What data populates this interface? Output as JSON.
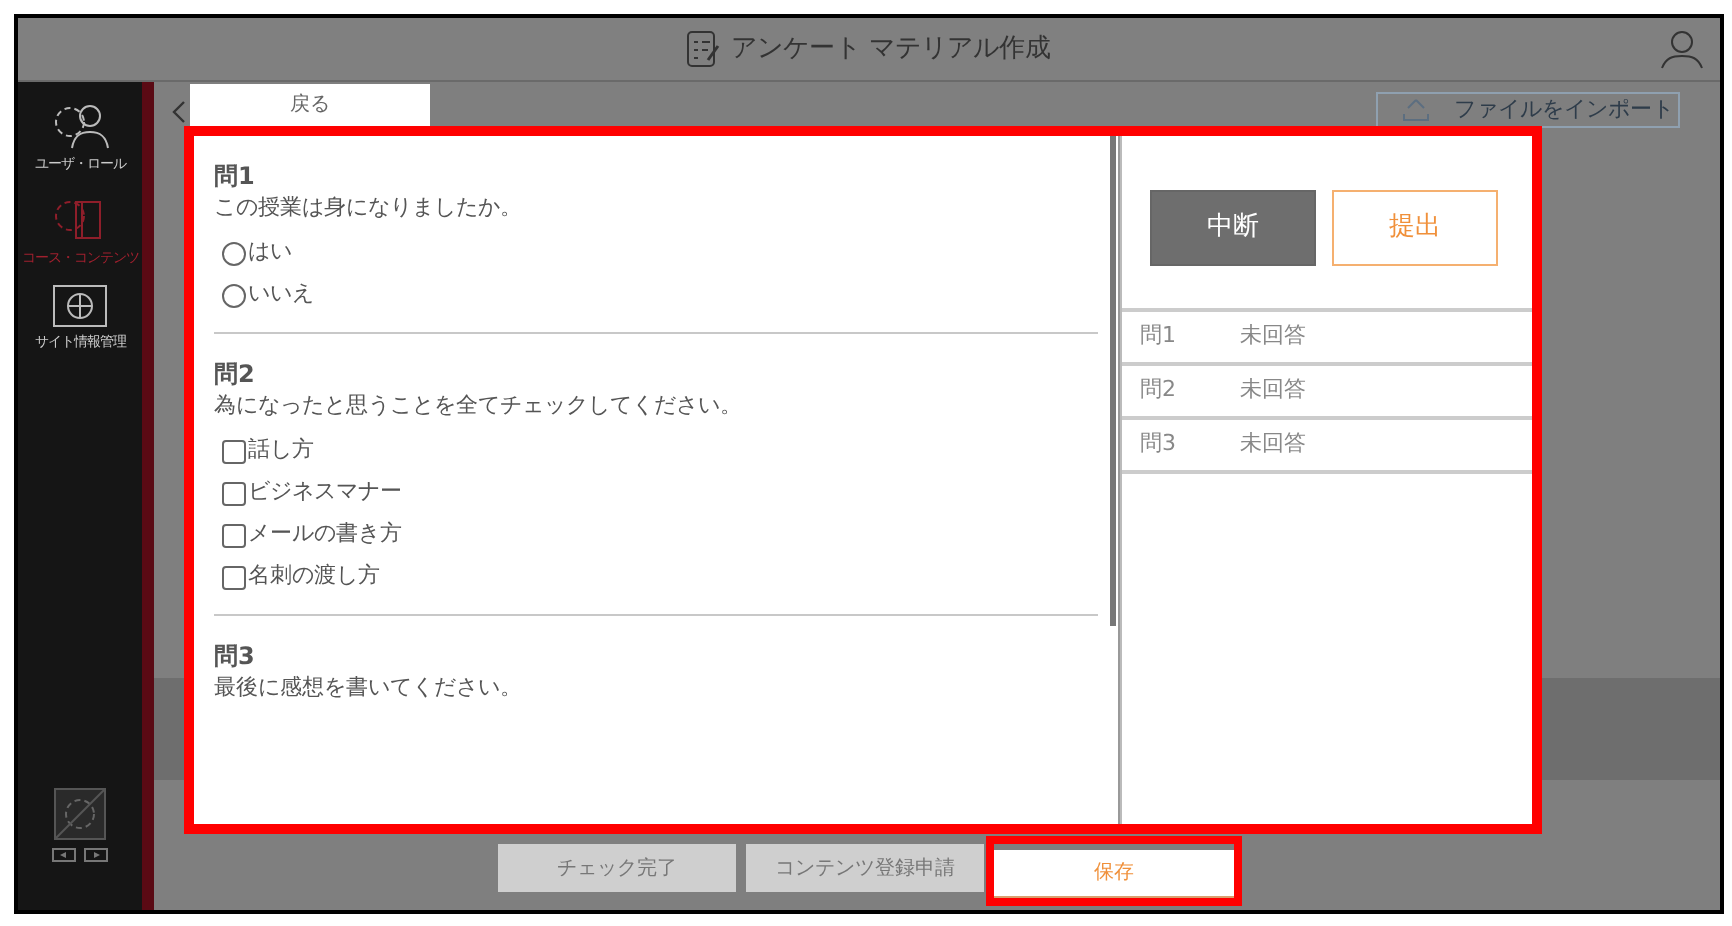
{
  "header": {
    "title": "アンケート マテリアル作成"
  },
  "sidebar": {
    "items": [
      {
        "label": "ユーザ・ロール",
        "kind": "users",
        "selected": false
      },
      {
        "label": "コース・コンテンツ",
        "kind": "course",
        "selected": true
      },
      {
        "label": "サイト情報管理",
        "kind": "site",
        "selected": false
      }
    ]
  },
  "back_tab": {
    "label": "戻る"
  },
  "import_button": {
    "label": "ファイルをインポート"
  },
  "questions": [
    {
      "title": "問1",
      "text": "この授業は身になりましたか。",
      "kind": "radio",
      "options": [
        {
          "label": "はい",
          "checked": false
        },
        {
          "label": "いいえ",
          "checked": false
        }
      ]
    },
    {
      "title": "問2",
      "text": "為になったと思うことを全てチェックしてください。",
      "kind": "checkbox",
      "options": [
        {
          "label": "話し方",
          "checked": false
        },
        {
          "label": "ビジネスマナー",
          "checked": false
        },
        {
          "label": "メールの書き方",
          "checked": false
        },
        {
          "label": "名刺の渡し方",
          "checked": false
        }
      ]
    },
    {
      "title": "問3",
      "text": "最後に感想を書いてください。",
      "kind": "text"
    }
  ],
  "actions": [
    {
      "label": "中断",
      "kind": "dark"
    },
    {
      "label": "提出",
      "kind": "outline"
    }
  ],
  "status": [
    {
      "question": "問1",
      "state": "未回答"
    },
    {
      "question": "問2",
      "state": "未回答"
    },
    {
      "question": "問3",
      "state": "未回答"
    }
  ],
  "footer_buttons": [
    {
      "label": "チェック完了",
      "highlighted": false
    },
    {
      "label": "コンテンツ登録申請",
      "highlighted": false
    },
    {
      "label": "保存",
      "highlighted": true
    }
  ]
}
